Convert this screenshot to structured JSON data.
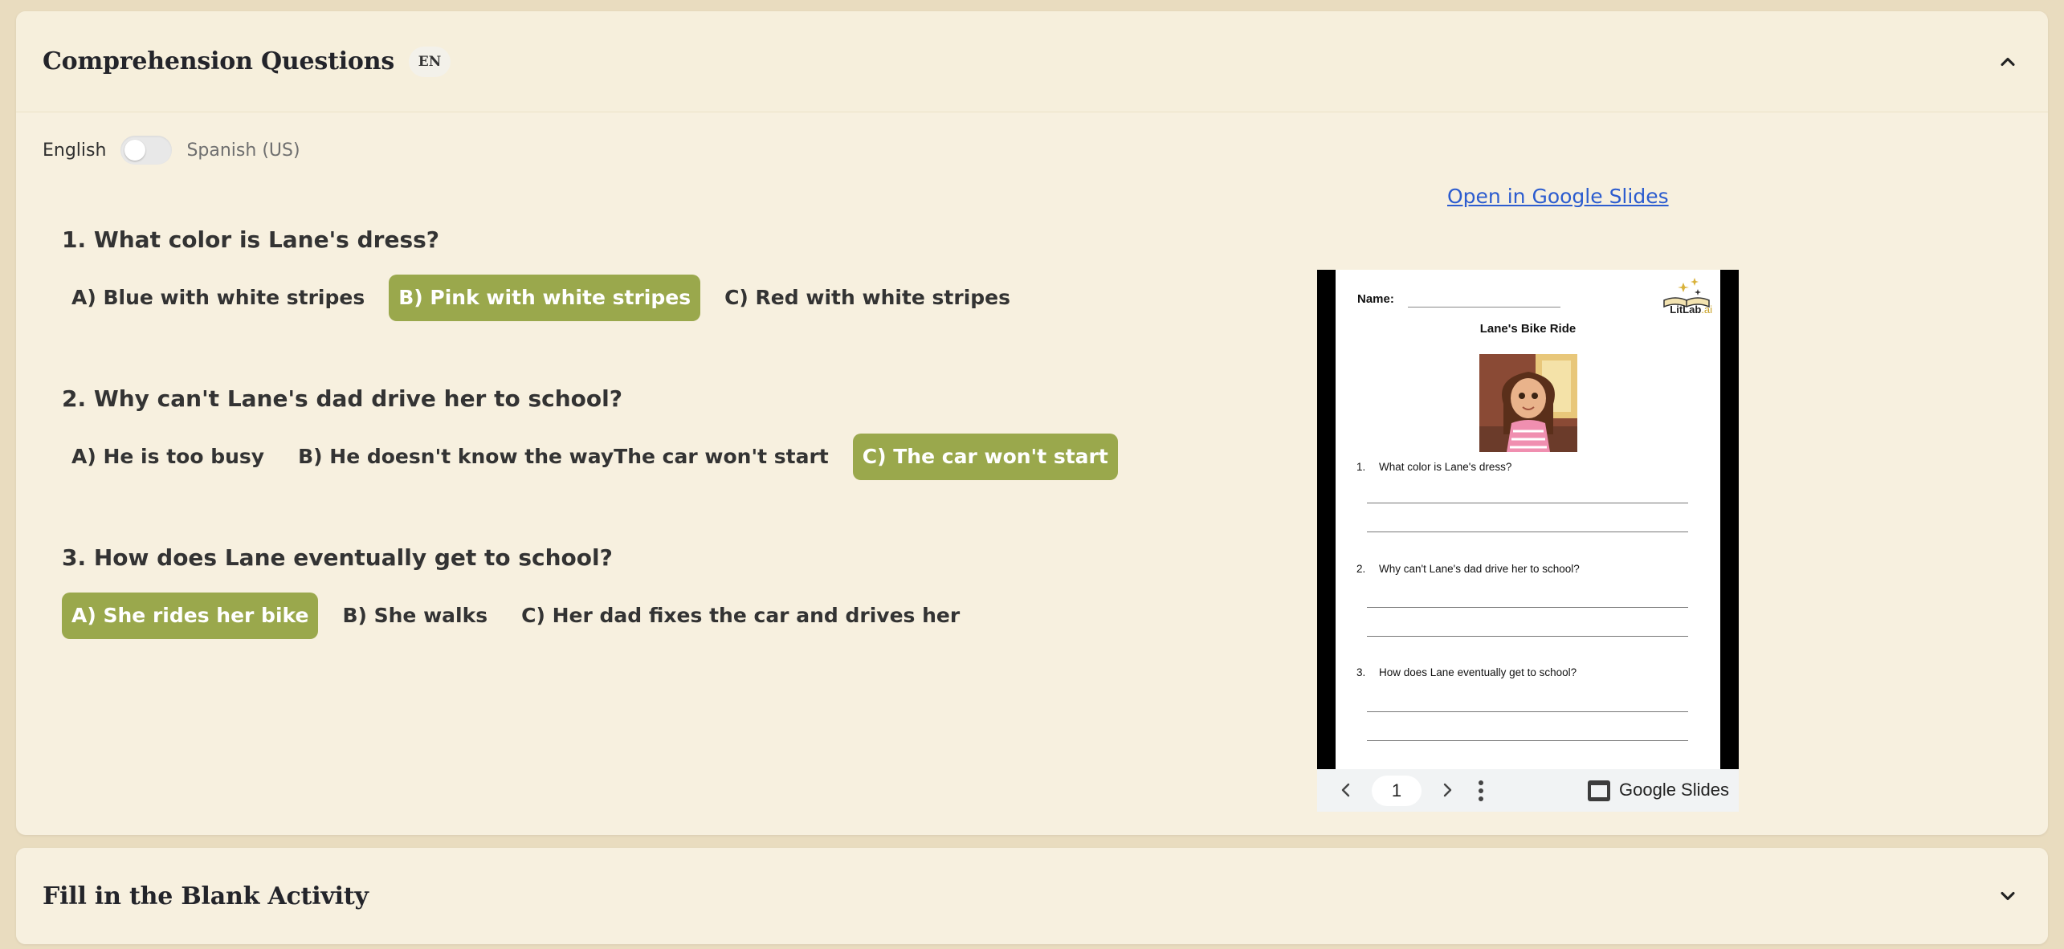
{
  "questions_panel": {
    "title": "Comprehension Questions",
    "lang_badge": "EN",
    "collapse_icon": "chevron-up-icon"
  },
  "language_toggle": {
    "left_label": "English",
    "right_label": "Spanish (US)",
    "state": "English"
  },
  "questions": [
    {
      "text": "1. What color is Lane's dress?",
      "options": [
        "A) Blue with white stripes",
        "B) Pink with white stripes",
        "C) Red with white stripes"
      ],
      "selected": "B) Pink with white stripes"
    },
    {
      "text": "2. Why can't Lane's dad drive her to school?",
      "options": [
        "A) He is too busy",
        "B) He doesn't know the wayThe car won't start",
        "C) The car won't start"
      ],
      "selected": "C) The car won't start"
    },
    {
      "text": "3. How does Lane eventually get to school?",
      "options": [
        "A) She rides her bike",
        "B) She walks",
        "C) Her dad fixes the car and drives her"
      ],
      "selected": "A) She rides her bike"
    }
  ],
  "slides": {
    "open_link": "Open in Google Slides",
    "worksheet": {
      "name_label": "Name:",
      "logo_text_main": "LitLab",
      "logo_text_suffix": ".ai",
      "title": "Lane's Bike Ride",
      "questions": [
        {
          "num": "1.",
          "text": "What color is Lane's dress?"
        },
        {
          "num": "2.",
          "text": "Why can't Lane's dad drive her to school?"
        },
        {
          "num": "3.",
          "text": "How does Lane eventually get to school?"
        }
      ]
    },
    "toolbar": {
      "page": "1",
      "brand_label": "Google Slides"
    }
  },
  "fill_panel": {
    "title": "Fill in the Blank Activity",
    "expand_icon": "chevron-down-icon"
  },
  "colors": {
    "background": "#e9dcbf",
    "panel": "#f7f0df",
    "selected_option": "#9aa84c",
    "link": "#2c5ccf"
  }
}
